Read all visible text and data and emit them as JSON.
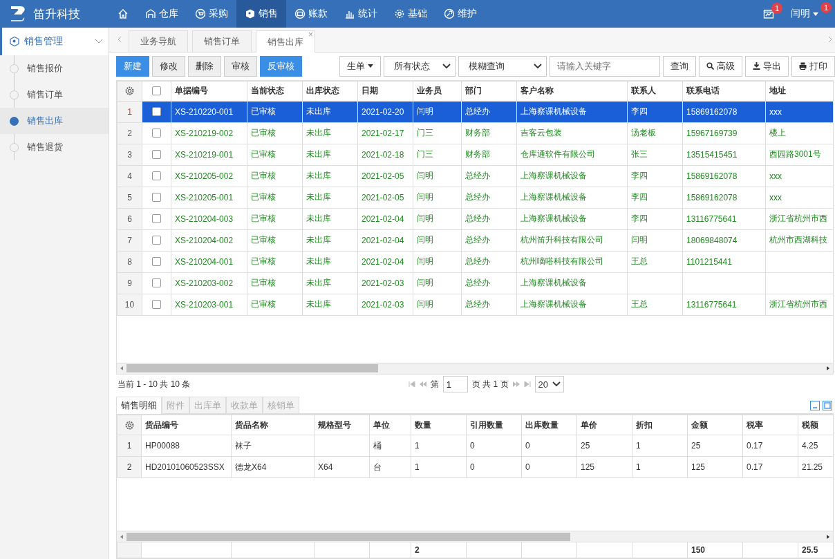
{
  "app": {
    "name": "笛升科技"
  },
  "nav": [
    {
      "label": "仓库",
      "selected": false
    },
    {
      "label": "采购",
      "selected": false
    },
    {
      "label": "销售",
      "selected": true
    },
    {
      "label": "账款",
      "selected": false
    },
    {
      "label": "统计",
      "selected": false
    },
    {
      "label": "基础",
      "selected": false
    },
    {
      "label": "维护",
      "selected": false
    }
  ],
  "notifications": {
    "badge": "1"
  },
  "user": {
    "name": "闫明",
    "badge": "1"
  },
  "sidebar": {
    "title": "销售管理",
    "expanded": true,
    "items": [
      {
        "label": "销售报价",
        "selected": false
      },
      {
        "label": "销售订单",
        "selected": false
      },
      {
        "label": "销售出库",
        "selected": true
      },
      {
        "label": "销售退货",
        "selected": false
      }
    ]
  },
  "tabs": [
    {
      "label": "业务导航",
      "selected": false
    },
    {
      "label": "销售订单",
      "selected": false
    },
    {
      "label": "销售出库",
      "selected": true,
      "close": "×"
    }
  ],
  "toolbar": {
    "buttons": [
      {
        "label": "新建",
        "kind": "primary"
      },
      {
        "label": "修改",
        "kind": "plain"
      },
      {
        "label": "删除",
        "kind": "plain"
      },
      {
        "label": "审核",
        "kind": "plain"
      },
      {
        "label": "反审核",
        "kind": "primary"
      }
    ],
    "generate": "生单",
    "status_filter": "所有状态",
    "query_mode": "模糊查询",
    "search": {
      "placeholder": "请输入关键字"
    },
    "actions": [
      "查询",
      "高级",
      "导出",
      "打印"
    ]
  },
  "table": {
    "header_checked": false,
    "columns": [
      "单据编号",
      "当前状态",
      "出库状态",
      "日期",
      "业务员",
      "部门",
      "客户名称",
      "联系人",
      "联系电话",
      "地址"
    ],
    "rows": [
      {
        "index": "1",
        "selected": true,
        "checked": false,
        "cells": [
          "XS-210220-001",
          "已审核",
          "未出库",
          "2021-02-20",
          "闫明",
          "总经办",
          "上海察课机械设备",
          "李四",
          "15869162078",
          "xxx"
        ]
      },
      {
        "index": "2",
        "selected": false,
        "checked": false,
        "cells": [
          "XS-210219-002",
          "已审核",
          "未出库",
          "2021-02-17",
          "门三",
          "财务部",
          "吉客云包装",
          "汤老板",
          "15967169739",
          "楼上"
        ]
      },
      {
        "index": "3",
        "selected": false,
        "checked": false,
        "cells": [
          "XS-210219-001",
          "已审核",
          "未出库",
          "2021-02-18",
          "门三",
          "财务部",
          "仓库通软件有限公司",
          "张三",
          "13515415451",
          "西园路3001号"
        ]
      },
      {
        "index": "4",
        "selected": false,
        "checked": false,
        "cells": [
          "XS-210205-002",
          "已审核",
          "未出库",
          "2021-02-05",
          "闫明",
          "总经办",
          "上海察课机械设备",
          "李四",
          "15869162078",
          "xxx"
        ]
      },
      {
        "index": "5",
        "selected": false,
        "checked": false,
        "cells": [
          "XS-210205-001",
          "已审核",
          "未出库",
          "2021-02-05",
          "闫明",
          "总经办",
          "上海察课机械设备",
          "李四",
          "15869162078",
          "xxx"
        ]
      },
      {
        "index": "6",
        "selected": false,
        "checked": false,
        "cells": [
          "XS-210204-003",
          "已审核",
          "未出库",
          "2021-02-04",
          "闫明",
          "总经办",
          "上海察课机械设备",
          "李四",
          "13116775641",
          "浙江省杭州市西"
        ]
      },
      {
        "index": "7",
        "selected": false,
        "checked": false,
        "cells": [
          "XS-210204-002",
          "已审核",
          "未出库",
          "2021-02-04",
          "闫明",
          "总经办",
          "杭州笛升科技有限公司",
          "闫明",
          "18069848074",
          "杭州市西湖科技"
        ]
      },
      {
        "index": "8",
        "selected": false,
        "checked": false,
        "cells": [
          "XS-210204-001",
          "已审核",
          "未出库",
          "2021-02-04",
          "闫明",
          "总经办",
          "杭州嘀嗒科技有限公司",
          "王总",
          "1101215441",
          null
        ]
      },
      {
        "index": "9",
        "selected": false,
        "checked": false,
        "cells": [
          "XS-210203-002",
          "已审核",
          "未出库",
          "2021-02-03",
          "闫明",
          "总经办",
          "上海察课机械设备",
          null,
          null,
          null
        ]
      },
      {
        "index": "10",
        "selected": false,
        "checked": false,
        "cells": [
          "XS-210203-001",
          "已审核",
          "未出库",
          "2021-02-03",
          "闫明",
          "总经办",
          "上海察课机械设备",
          "王总",
          "13116775641",
          "浙江省杭州市西"
        ]
      }
    ]
  },
  "pager": {
    "summary": "当前 1 - 10 共 10 条",
    "page_prefix": "第",
    "page": "1",
    "page_suffix": "页 共 1 页",
    "page_size": "20"
  },
  "detail": {
    "tabs": [
      {
        "label": "销售明细",
        "selected": true
      },
      {
        "label": "附件",
        "selected": false
      },
      {
        "label": "出库单",
        "selected": false
      },
      {
        "label": "收款单",
        "selected": false
      },
      {
        "label": "核销单",
        "selected": false
      }
    ],
    "columns": [
      {
        "label": "货品编号"
      },
      {
        "label": "货品名称"
      },
      {
        "label": "规格型号"
      },
      {
        "label": "单位"
      },
      {
        "label": "数量",
        "total": "2"
      },
      {
        "label": "引用数量"
      },
      {
        "label": "出库数量"
      },
      {
        "label": "单价"
      },
      {
        "label": "折扣"
      },
      {
        "label": "金额",
        "total": "150"
      },
      {
        "label": "税率"
      },
      {
        "label": "税额",
        "total": "25.5"
      }
    ],
    "rows": [
      {
        "index": "1",
        "cells": [
          "HP00088",
          "袜子",
          null,
          "桶",
          "1",
          "0",
          "0",
          "25",
          "1",
          "25",
          "0.17",
          "4.25"
        ]
      },
      {
        "index": "2",
        "cells": [
          "HD20101060523SSX",
          "德龙X64",
          "X64",
          "台",
          "1",
          "0",
          "0",
          "125",
          "1",
          "125",
          "0.17",
          "21.25"
        ]
      }
    ]
  }
}
